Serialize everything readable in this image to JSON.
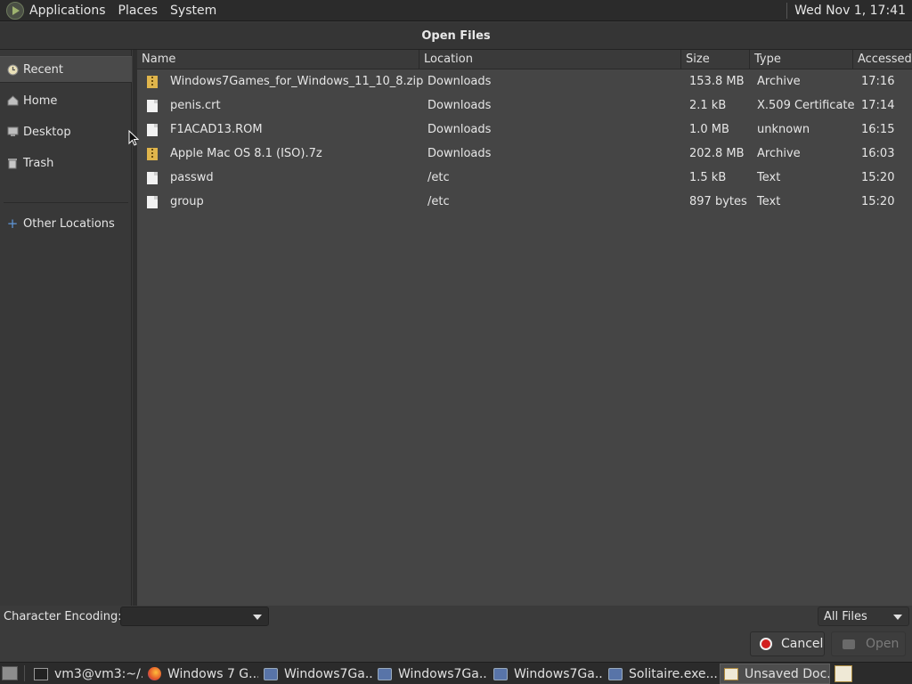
{
  "top_panel": {
    "menus": [
      "Applications",
      "Places",
      "System"
    ],
    "clock": "Wed Nov 1, 17:41"
  },
  "dialog": {
    "title": "Open Files"
  },
  "sidebar": {
    "items": [
      {
        "label": "Recent",
        "icon": "recent-icon",
        "active": true
      },
      {
        "label": "Home",
        "icon": "home-icon"
      },
      {
        "label": "Desktop",
        "icon": "desktop-icon"
      },
      {
        "label": "Trash",
        "icon": "trash-icon"
      },
      {
        "label": "Other Locations",
        "icon": "plus-icon"
      }
    ]
  },
  "filelist": {
    "columns": [
      "Name",
      "Location",
      "Size",
      "Type",
      "Accessed"
    ],
    "rows": [
      {
        "icon": "archive-icon",
        "name": "Windows7Games_for_Windows_11_10_8.zip",
        "location": "Downloads",
        "size": "153.8 MB",
        "type": "Archive",
        "accessed": "17:16"
      },
      {
        "icon": "file-icon",
        "name": "penis.crt",
        "location": "Downloads",
        "size": "2.1 kB",
        "type": "X.509 Certificate",
        "accessed": "17:14"
      },
      {
        "icon": "file-icon",
        "name": "F1ACAD13.ROM",
        "location": "Downloads",
        "size": "1.0 MB",
        "type": "unknown",
        "accessed": "16:15"
      },
      {
        "icon": "archive-icon",
        "name": "Apple Mac OS 8.1 (ISO).7z",
        "location": "Downloads",
        "size": "202.8 MB",
        "type": "Archive",
        "accessed": "16:03"
      },
      {
        "icon": "file-icon",
        "name": "passwd",
        "location": "/etc",
        "size": "1.5 kB",
        "type": "Text",
        "accessed": "15:20"
      },
      {
        "icon": "file-icon",
        "name": "group",
        "location": "/etc",
        "size": "897 bytes",
        "type": "Text",
        "accessed": "15:20"
      }
    ]
  },
  "bottom": {
    "encoding_label": "Character Encoding:",
    "encoding_value": "",
    "filter_value": "All Files",
    "cancel_label": "Cancel",
    "open_label": "Open"
  },
  "taskbar": {
    "tasks": [
      {
        "label": "vm3@vm3:~/...",
        "icon": "terminal-icon"
      },
      {
        "label": "Windows 7 G...",
        "icon": "firefox-icon"
      },
      {
        "label": "Windows7Ga...",
        "icon": "wine-icon"
      },
      {
        "label": "Windows7Ga...",
        "icon": "wine-icon"
      },
      {
        "label": "Windows7Ga...",
        "icon": "wine-icon"
      },
      {
        "label": "Solitaire.exe....",
        "icon": "wine-icon"
      },
      {
        "label": "Unsaved Doc...",
        "icon": "text-editor-icon",
        "active": true
      }
    ]
  },
  "colors": {
    "panel_bg": "#2b2b2b",
    "list_bg": "#454545",
    "cancel_red": "#d21f1f",
    "archive_yellow": "#e0b54c"
  }
}
